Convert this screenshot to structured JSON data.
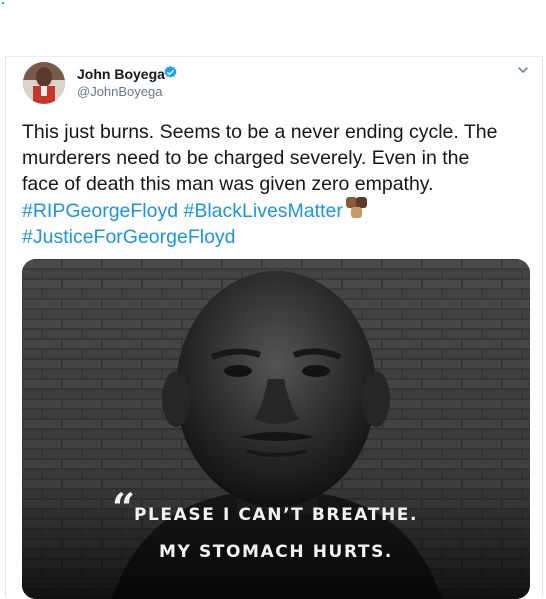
{
  "tweet": {
    "author_name": "John Boyega",
    "author_handle": "@JohnBoyega",
    "verified": true,
    "text_lines": [
      "This just burns. Seems to be a never ending cycle. The",
      "murderers need to be charged severely. Even in the",
      "face of death this man was given zero empathy."
    ],
    "hashtags": [
      "#RIPGeorgeFloyd",
      "#BlackLivesMatter",
      "#JusticeForGeorgeFloyd"
    ],
    "emoji": "raised-fists-multi-skin-tone",
    "media": {
      "quote_mark": "“",
      "caption_line1": "PLEASE I CAN’T BREATHE.",
      "caption_line2": "MY STOMACH HURTS."
    }
  },
  "colors": {
    "hashtag": "#1b95e0",
    "text": "#14171a",
    "handle": "#657786",
    "verified": "#1da1f2"
  },
  "icons": {
    "verified": "verified-badge-icon",
    "caret": "chevron-down-icon"
  }
}
